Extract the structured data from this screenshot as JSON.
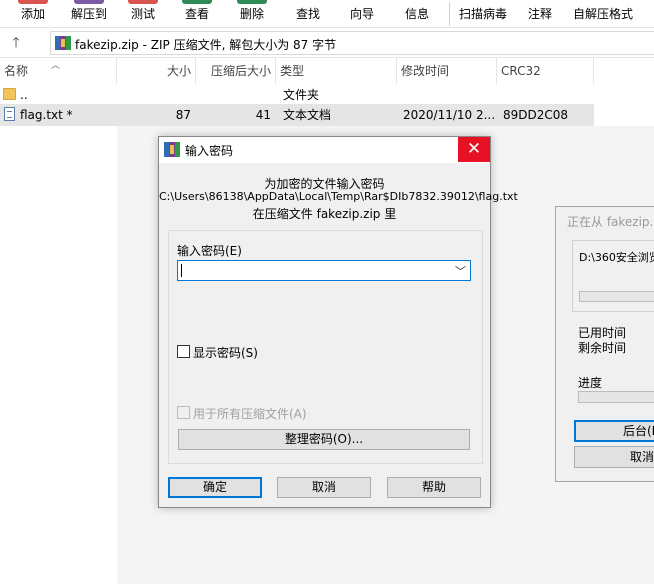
{
  "toolbar": {
    "items": [
      {
        "label": "添加",
        "icon": "add-icon",
        "color": "#d9534f"
      },
      {
        "label": "解压到",
        "icon": "extract-to-icon",
        "color": "#7b5aa6"
      },
      {
        "label": "测试",
        "icon": "test-icon",
        "color": "#d9534f"
      },
      {
        "label": "查看",
        "icon": "view-icon",
        "color": "#2e8b57"
      },
      {
        "label": "删除",
        "icon": "delete-icon",
        "color": "#2e8b57"
      },
      {
        "label": "查找",
        "icon": "find-icon",
        "color": "#5b6fa0"
      },
      {
        "label": "向导",
        "icon": "wizard-icon",
        "color": "#c0392b"
      },
      {
        "label": "信息",
        "icon": "info-icon",
        "color": "#3a6fb0"
      },
      {
        "label": "扫描病毒",
        "icon": "scan-virus-icon",
        "color": "#2e7d32"
      },
      {
        "label": "注释",
        "icon": "comment-icon",
        "color": "#888888"
      },
      {
        "label": "自解压格式",
        "icon": "sfx-icon",
        "color": "#5b6fa0"
      }
    ]
  },
  "address": {
    "text": "fakezip.zip - ZIP 压缩文件, 解包大小为 87 字节"
  },
  "columns": {
    "name": "名称",
    "size": "大小",
    "packed": "压缩后大小",
    "type": "类型",
    "modified": "修改时间",
    "crc": "CRC32"
  },
  "rows": [
    {
      "name": "..",
      "size": "",
      "packed": "",
      "type": "文件夹",
      "modified": "",
      "crc": ""
    },
    {
      "name": "flag.txt *",
      "size": "87",
      "packed": "41",
      "type": "文本文档",
      "modified": "2020/11/10 2...",
      "crc": "89DD2C08"
    }
  ],
  "progress_dialog": {
    "title": "正在从 fakezip.z",
    "path": "D:\\360安全浏览",
    "elapsed_label": "已用时间",
    "remaining_label": "剩余时间",
    "progress_label": "进度",
    "background_button": "后台(B",
    "cancel_button": "取消"
  },
  "password_dialog": {
    "title": "输入密码",
    "close_symbol": "✕",
    "line1": "为加密的文件输入密码",
    "line2": "C:\\Users\\86138\\AppData\\Local\\Temp\\Rar$DIb7832.39012\\flag.txt",
    "line3": "在压缩文件 fakezip.zip 里",
    "password_label": "输入密码(E)",
    "password_value": "",
    "show_password_label": "显示密码(S)",
    "use_for_all_label": "用于所有压缩文件(A)",
    "organize_button": "整理密码(O)...",
    "ok_button": "确定",
    "cancel_button": "取消",
    "help_button": "帮助"
  }
}
